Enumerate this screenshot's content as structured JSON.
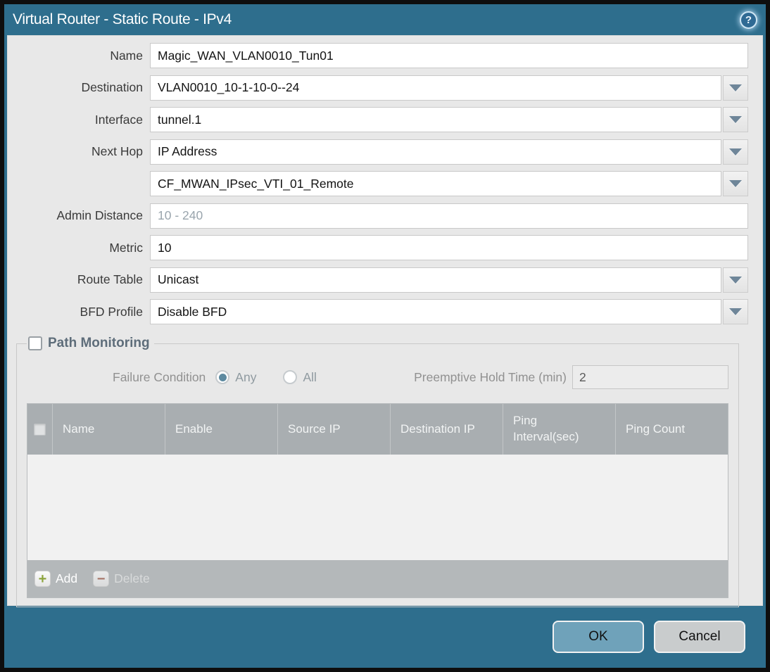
{
  "titlebar": {
    "title": "Virtual Router - Static Route - IPv4"
  },
  "colors": {
    "frame_teal": "#2e6e8d",
    "panel_gray": "#e8e8e8",
    "table_header_gray": "#a9aeb1",
    "ok_button_blue": "#6fa2ba",
    "cancel_button_gray": "#c9cccd",
    "add_plus_green": "#8da43d",
    "delete_minus_red": "#a3614f",
    "dropdown_arrow": "#6f8699",
    "radio_selected_dot": "#5d8aa0"
  },
  "form": {
    "fields": [
      {
        "label": "Name",
        "value": "Magic_WAN_VLAN0010_Tun01",
        "type": "text"
      },
      {
        "label": "Destination",
        "value": "VLAN0010_10-1-10-0--24",
        "type": "combo"
      },
      {
        "label": "Interface",
        "value": "tunnel.1",
        "type": "combo"
      },
      {
        "label": "Next Hop",
        "value": "IP Address",
        "type": "combo"
      },
      {
        "label": "",
        "value": "CF_MWAN_IPsec_VTI_01_Remote",
        "type": "combo"
      },
      {
        "label": "Admin Distance",
        "value": "",
        "placeholder": "10 - 240",
        "type": "text"
      },
      {
        "label": "Metric",
        "value": "10",
        "type": "text"
      },
      {
        "label": "Route Table",
        "value": "Unicast",
        "type": "combo"
      },
      {
        "label": "BFD Profile",
        "value": "Disable BFD",
        "type": "combo"
      }
    ]
  },
  "path_monitoring": {
    "legend": "Path Monitoring",
    "checkbox_checked": false,
    "failure_condition": {
      "label": "Failure Condition",
      "options": [
        {
          "label": "Any",
          "selected": true
        },
        {
          "label": "All",
          "selected": false
        }
      ]
    },
    "preemptive_hold_time": {
      "label": "Preemptive Hold Time (min)",
      "value": "2"
    },
    "table": {
      "columns": [
        "Name",
        "Enable",
        "Source IP",
        "Destination IP",
        "Ping Interval(sec)",
        "Ping Count"
      ],
      "rows": [],
      "add_label": "Add",
      "delete_label": "Delete"
    }
  },
  "footer": {
    "ok_label": "OK",
    "cancel_label": "Cancel"
  }
}
